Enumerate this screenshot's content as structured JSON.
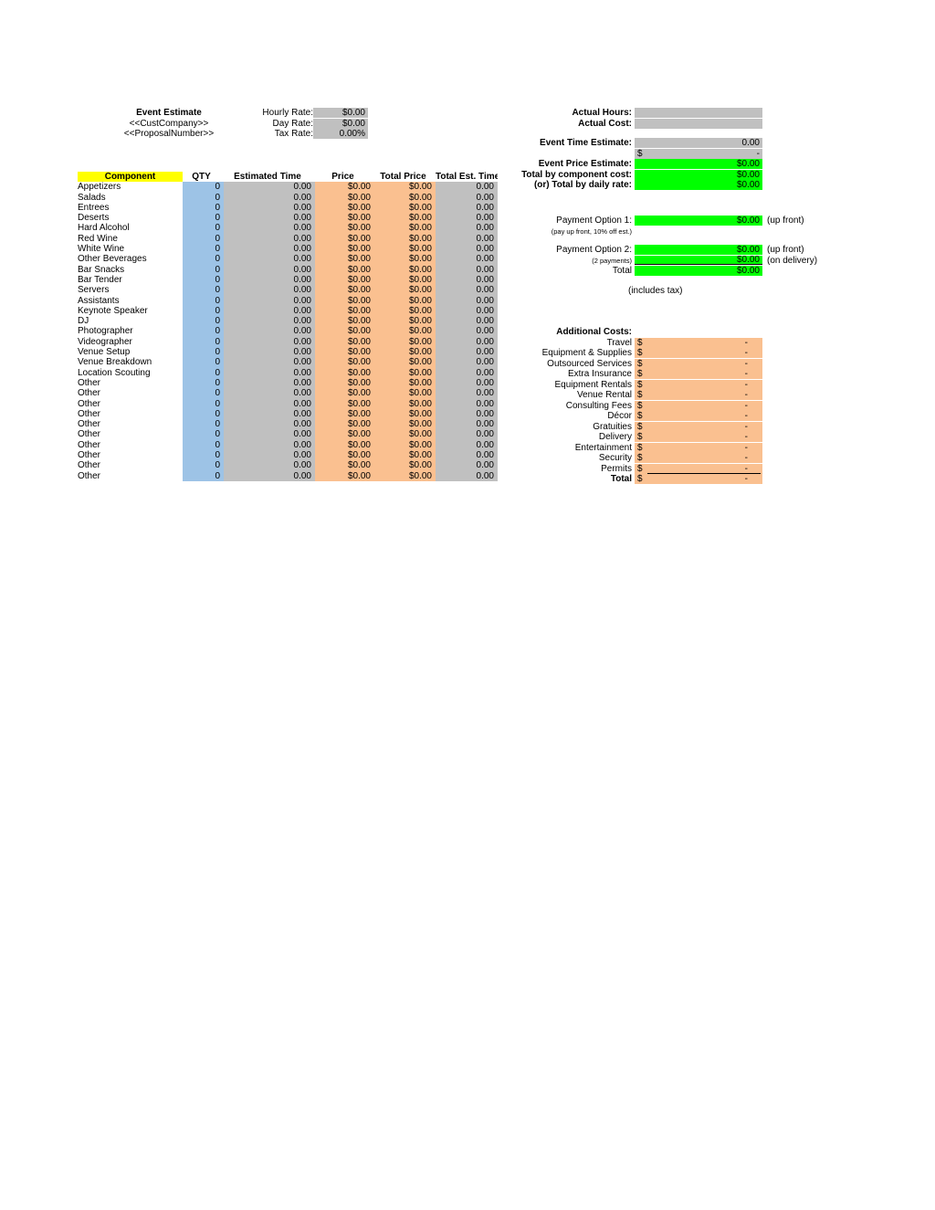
{
  "header": {
    "title": "Event Estimate",
    "company_placeholder": "<<CustCompany>>",
    "proposal_placeholder": "<<ProposalNumber>>"
  },
  "rates": {
    "items": [
      {
        "label": "Hourly Rate:",
        "value": "$0.00"
      },
      {
        "label": "Day Rate:",
        "value": "$0.00"
      },
      {
        "label": "Tax Rate:",
        "value": "0.00%"
      }
    ]
  },
  "actuals": {
    "items": [
      {
        "label": "Actual Hours:",
        "value": ""
      },
      {
        "label": "Actual Cost:",
        "value": ""
      }
    ]
  },
  "event_estimate": {
    "time_label": "Event Time Estimate:",
    "time_value": "0.00",
    "cost_dollar": "$",
    "cost_value": "-",
    "price_label": "Event Price Estimate:",
    "price_value": "$0.00",
    "component_label": "Total by component cost:",
    "component_value": "$0.00",
    "daily_label": "(or) Total by daily rate:",
    "daily_value": "$0.00"
  },
  "payment_option_1": {
    "label": "Payment Option 1:",
    "value": "$0.00",
    "note": "(up front)",
    "sub_label": "(pay up front, 10% off est.)"
  },
  "payment_option_2": {
    "label": "Payment Option 2:",
    "value": "$0.00",
    "note": "(up front)",
    "sub_label": "(2 payments)",
    "sub_value": "$0.00",
    "sub_note": "(on delivery)",
    "total_label": "Total",
    "total_value": "$0.00",
    "includes_tax": "(includes tax)"
  },
  "table": {
    "columns": [
      "Component",
      "QTY",
      "Estimated Time",
      "Price",
      "Total Price",
      "Total Est. Time"
    ],
    "rows": [
      {
        "component": "Appetizers",
        "qty": "0",
        "est_time": "0.00",
        "price": "$0.00",
        "total_price": "$0.00",
        "total_est_time": "0.00"
      },
      {
        "component": "Salads",
        "qty": "0",
        "est_time": "0.00",
        "price": "$0.00",
        "total_price": "$0.00",
        "total_est_time": "0.00"
      },
      {
        "component": "Entrees",
        "qty": "0",
        "est_time": "0.00",
        "price": "$0.00",
        "total_price": "$0.00",
        "total_est_time": "0.00"
      },
      {
        "component": "Deserts",
        "qty": "0",
        "est_time": "0.00",
        "price": "$0.00",
        "total_price": "$0.00",
        "total_est_time": "0.00"
      },
      {
        "component": "Hard Alcohol",
        "qty": "0",
        "est_time": "0.00",
        "price": "$0.00",
        "total_price": "$0.00",
        "total_est_time": "0.00"
      },
      {
        "component": "Red Wine",
        "qty": "0",
        "est_time": "0.00",
        "price": "$0.00",
        "total_price": "$0.00",
        "total_est_time": "0.00"
      },
      {
        "component": "White Wine",
        "qty": "0",
        "est_time": "0.00",
        "price": "$0.00",
        "total_price": "$0.00",
        "total_est_time": "0.00"
      },
      {
        "component": "Other Beverages",
        "qty": "0",
        "est_time": "0.00",
        "price": "$0.00",
        "total_price": "$0.00",
        "total_est_time": "0.00"
      },
      {
        "component": "Bar Snacks",
        "qty": "0",
        "est_time": "0.00",
        "price": "$0.00",
        "total_price": "$0.00",
        "total_est_time": "0.00"
      },
      {
        "component": "Bar Tender",
        "qty": "0",
        "est_time": "0.00",
        "price": "$0.00",
        "total_price": "$0.00",
        "total_est_time": "0.00"
      },
      {
        "component": "Servers",
        "qty": "0",
        "est_time": "0.00",
        "price": "$0.00",
        "total_price": "$0.00",
        "total_est_time": "0.00"
      },
      {
        "component": "Assistants",
        "qty": "0",
        "est_time": "0.00",
        "price": "$0.00",
        "total_price": "$0.00",
        "total_est_time": "0.00"
      },
      {
        "component": "Keynote Speaker",
        "qty": "0",
        "est_time": "0.00",
        "price": "$0.00",
        "total_price": "$0.00",
        "total_est_time": "0.00"
      },
      {
        "component": "DJ",
        "qty": "0",
        "est_time": "0.00",
        "price": "$0.00",
        "total_price": "$0.00",
        "total_est_time": "0.00"
      },
      {
        "component": "Photographer",
        "qty": "0",
        "est_time": "0.00",
        "price": "$0.00",
        "total_price": "$0.00",
        "total_est_time": "0.00"
      },
      {
        "component": "Videographer",
        "qty": "0",
        "est_time": "0.00",
        "price": "$0.00",
        "total_price": "$0.00",
        "total_est_time": "0.00"
      },
      {
        "component": "Venue Setup",
        "qty": "0",
        "est_time": "0.00",
        "price": "$0.00",
        "total_price": "$0.00",
        "total_est_time": "0.00"
      },
      {
        "component": "Venue Breakdown",
        "qty": "0",
        "est_time": "0.00",
        "price": "$0.00",
        "total_price": "$0.00",
        "total_est_time": "0.00"
      },
      {
        "component": "Location Scouting",
        "qty": "0",
        "est_time": "0.00",
        "price": "$0.00",
        "total_price": "$0.00",
        "total_est_time": "0.00"
      },
      {
        "component": "Other",
        "qty": "0",
        "est_time": "0.00",
        "price": "$0.00",
        "total_price": "$0.00",
        "total_est_time": "0.00"
      },
      {
        "component": "Other",
        "qty": "0",
        "est_time": "0.00",
        "price": "$0.00",
        "total_price": "$0.00",
        "total_est_time": "0.00"
      },
      {
        "component": "Other",
        "qty": "0",
        "est_time": "0.00",
        "price": "$0.00",
        "total_price": "$0.00",
        "total_est_time": "0.00"
      },
      {
        "component": "Other",
        "qty": "0",
        "est_time": "0.00",
        "price": "$0.00",
        "total_price": "$0.00",
        "total_est_time": "0.00"
      },
      {
        "component": "Other",
        "qty": "0",
        "est_time": "0.00",
        "price": "$0.00",
        "total_price": "$0.00",
        "total_est_time": "0.00"
      },
      {
        "component": "Other",
        "qty": "0",
        "est_time": "0.00",
        "price": "$0.00",
        "total_price": "$0.00",
        "total_est_time": "0.00"
      },
      {
        "component": "Other",
        "qty": "0",
        "est_time": "0.00",
        "price": "$0.00",
        "total_price": "$0.00",
        "total_est_time": "0.00"
      },
      {
        "component": "Other",
        "qty": "0",
        "est_time": "0.00",
        "price": "$0.00",
        "total_price": "$0.00",
        "total_est_time": "0.00"
      },
      {
        "component": "Other",
        "qty": "0",
        "est_time": "0.00",
        "price": "$0.00",
        "total_price": "$0.00",
        "total_est_time": "0.00"
      },
      {
        "component": "Other",
        "qty": "0",
        "est_time": "0.00",
        "price": "$0.00",
        "total_price": "$0.00",
        "total_est_time": "0.00"
      }
    ]
  },
  "additional_costs": {
    "title": "Additional Costs:",
    "dollar": "$",
    "dash": "-",
    "items": [
      {
        "label": "Travel",
        "value": "-"
      },
      {
        "label": "Equipment & Supplies",
        "value": "-"
      },
      {
        "label": "Outsourced Services",
        "value": "-"
      },
      {
        "label": "Extra Insurance",
        "value": "-"
      },
      {
        "label": "Equipment Rentals",
        "value": "-"
      },
      {
        "label": "Venue Rental",
        "value": "-"
      },
      {
        "label": "Consulting Fees",
        "value": "-"
      },
      {
        "label": "Décor",
        "value": "-"
      },
      {
        "label": "Gratuities",
        "value": "-"
      },
      {
        "label": "Delivery",
        "value": "-"
      },
      {
        "label": "Entertainment",
        "value": "-"
      },
      {
        "label": "Security",
        "value": "-"
      },
      {
        "label": "Permits",
        "value": "-"
      }
    ],
    "total_label": "Total",
    "total_value": "-"
  },
  "colors": {
    "gray": "#c0c0c0",
    "green": "#00ff00",
    "orange": "#fac090",
    "blue": "#9dc3e6",
    "yellow": "#ffff00"
  }
}
